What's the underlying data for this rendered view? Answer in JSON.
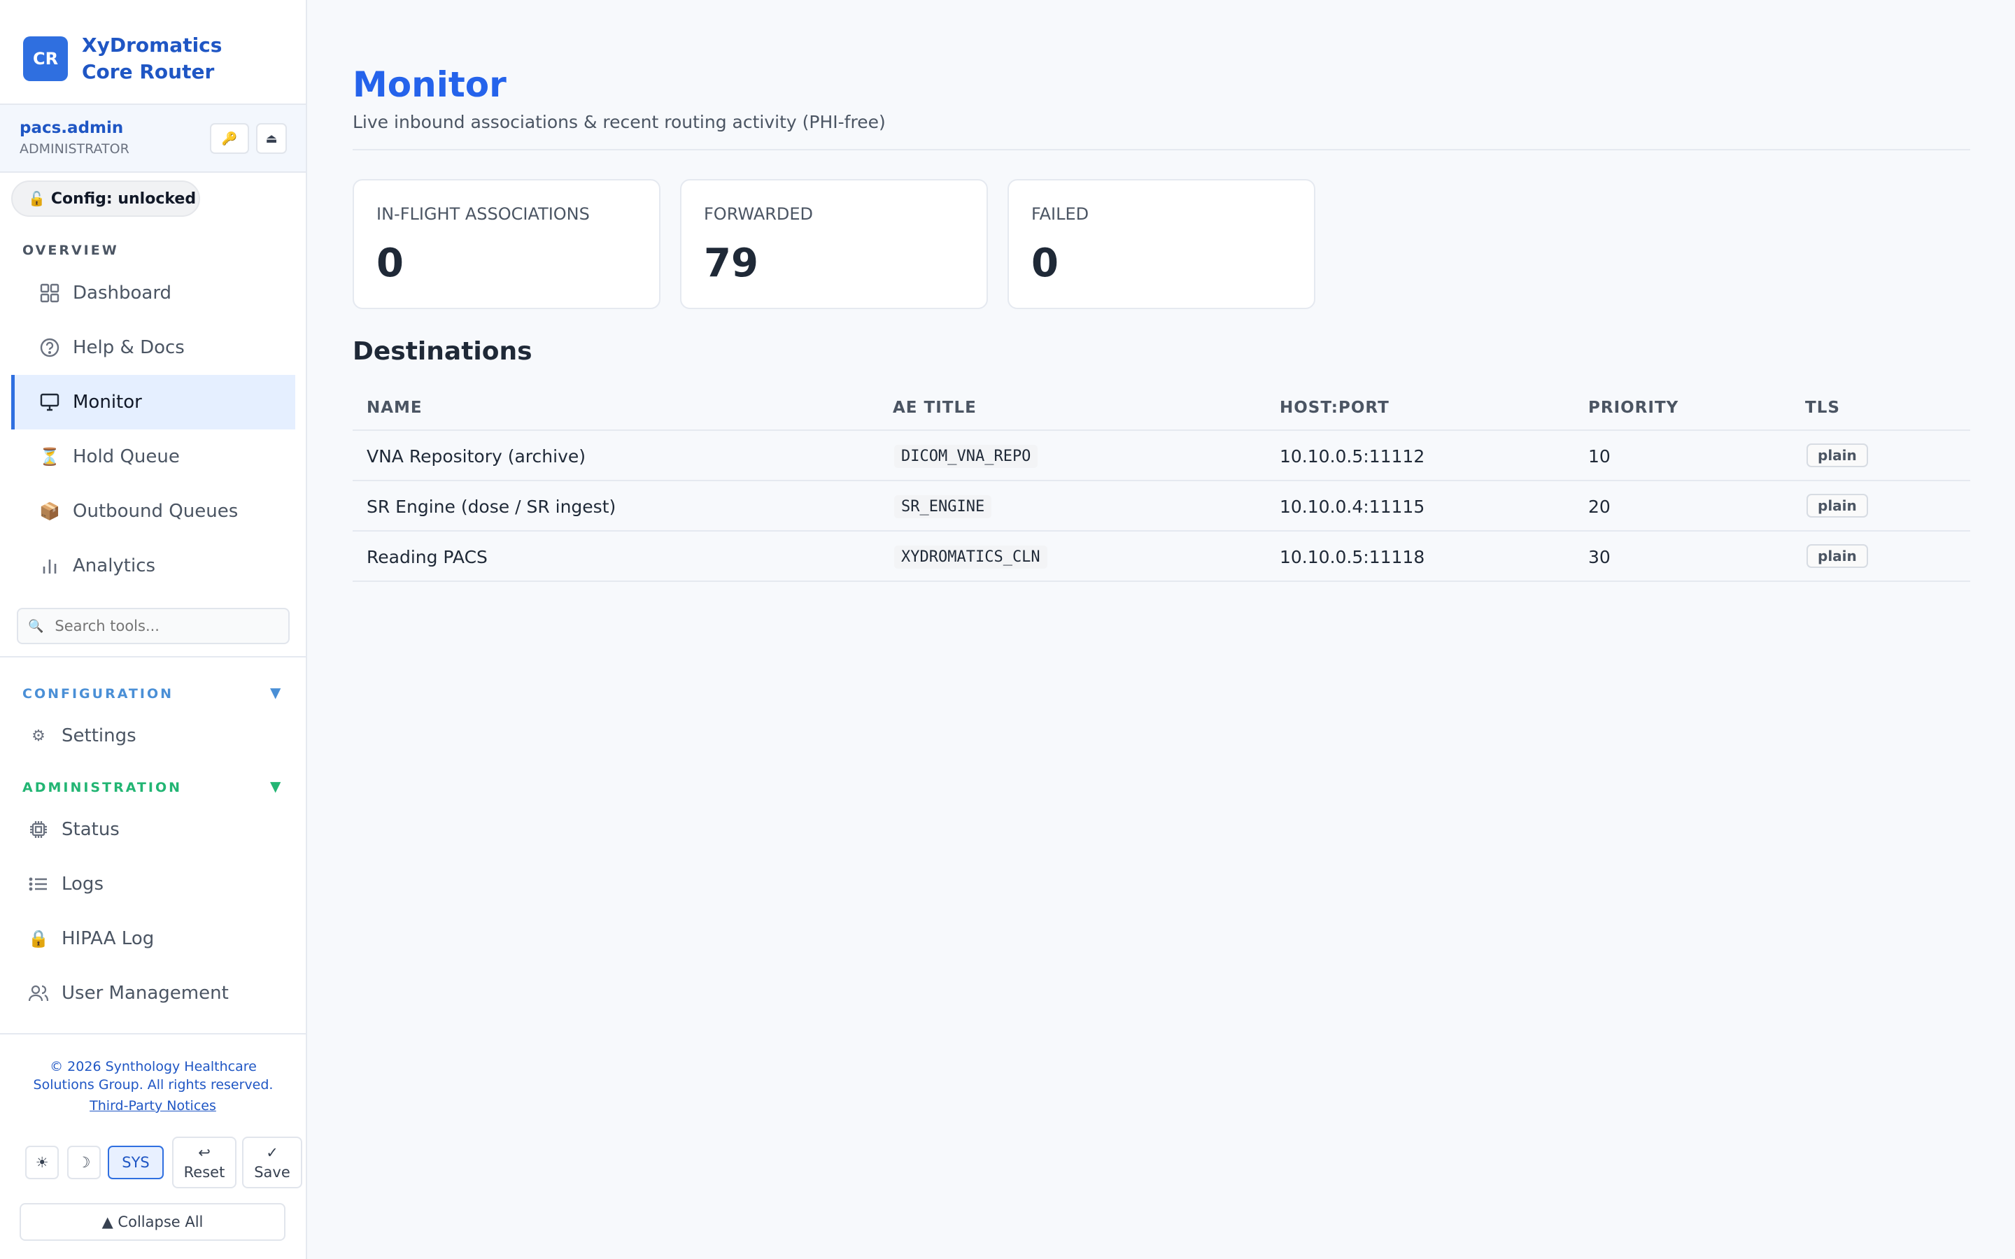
{
  "brand": {
    "logo": "CR",
    "line1": "XyDromatics",
    "line2": "Core Router"
  },
  "user": {
    "name": "pacs.admin",
    "role": "ADMINISTRATOR",
    "key_icon": "🔑",
    "eject_icon": "⏏"
  },
  "config_pill": {
    "icon": "🔓",
    "label": "Config: unlocked"
  },
  "sections": {
    "overview": "OVERVIEW",
    "configuration": "CONFIGURATION",
    "administration": "ADMINISTRATION"
  },
  "colors": {
    "accent": "#2f6fe0",
    "configuration": "#4a8fd6",
    "administration": "#22b573"
  },
  "nav": {
    "dashboard": "Dashboard",
    "help": "Help & Docs",
    "monitor": "Monitor",
    "hold_queue": "Hold Queue",
    "outbound": "Outbound Queues",
    "analytics": "Analytics",
    "settings": "Settings",
    "status": "Status",
    "logs": "Logs",
    "hipaa": "HIPAA Log",
    "users": "User Management"
  },
  "search": {
    "placeholder": "Search tools..."
  },
  "footer": {
    "copyright": "© 2026 Synthology Healthcare Solutions Group. All rights reserved.",
    "link": "Third-Party Notices",
    "theme_light": "☀",
    "theme_dark": "☽",
    "theme_sys": "SYS",
    "reset_icon": "↩",
    "reset": "Reset",
    "save_icon": "✓",
    "save": "Save",
    "collapse_all": "▲ Collapse All"
  },
  "page": {
    "title": "Monitor",
    "subtitle": "Live inbound associations & recent routing activity (PHI-free)"
  },
  "stats": [
    {
      "label": "IN-FLIGHT ASSOCIATIONS",
      "value": "0"
    },
    {
      "label": "FORWARDED",
      "value": "79"
    },
    {
      "label": "FAILED",
      "value": "0"
    }
  ],
  "destinations": {
    "title": "Destinations",
    "headers": [
      "NAME",
      "AE TITLE",
      "HOST:PORT",
      "PRIORITY",
      "TLS"
    ],
    "rows": [
      {
        "name": "VNA Repository (archive)",
        "ae": "DICOM_VNA_REPO",
        "host": "10.10.0.5:11112",
        "priority": "10",
        "tls": "plain"
      },
      {
        "name": "SR Engine (dose / SR ingest)",
        "ae": "SR_ENGINE",
        "host": "10.10.0.4:11115",
        "priority": "20",
        "tls": "plain"
      },
      {
        "name": "Reading PACS",
        "ae": "XYDROMATICS_CLN",
        "host": "10.10.0.5:11118",
        "priority": "30",
        "tls": "plain"
      }
    ]
  }
}
